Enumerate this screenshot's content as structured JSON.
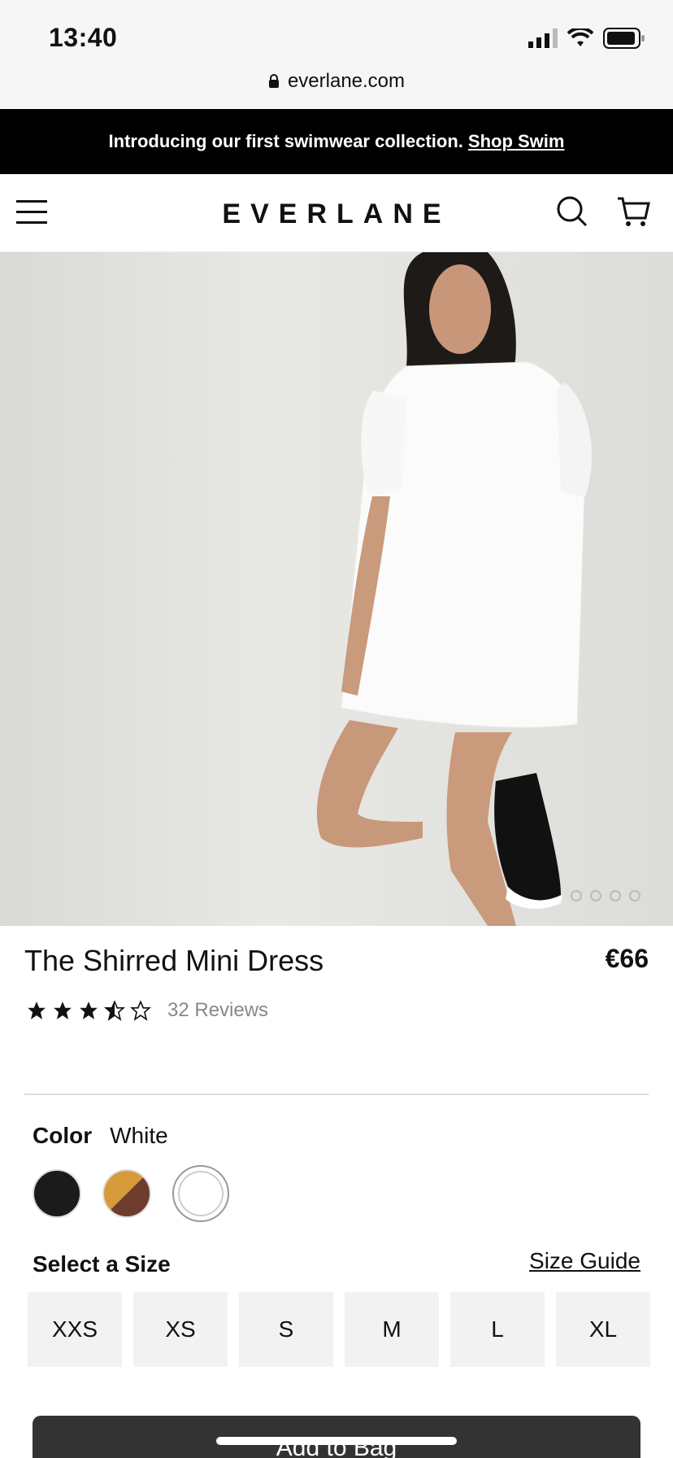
{
  "status_bar": {
    "time": "13:40"
  },
  "browser": {
    "url": "everlane.com"
  },
  "promo": {
    "text": "Introducing our first swimwear collection.",
    "link": "Shop Swim"
  },
  "header": {
    "logo": "EVERLANE"
  },
  "product": {
    "title": "The Shirred Mini Dress",
    "price": "€66",
    "rating": 3.5,
    "reviews": "32 Reviews",
    "image_dots": 4
  },
  "color": {
    "label": "Color",
    "selected": "White",
    "swatches": [
      {
        "name": "black",
        "color": "#1b1b1b"
      },
      {
        "name": "brown-ochre",
        "color": "#6e3c2c"
      },
      {
        "name": "white",
        "color": "#ffffff"
      }
    ]
  },
  "size": {
    "label": "Select a Size",
    "guide": "Size Guide",
    "options": [
      "XXS",
      "XS",
      "S",
      "M",
      "L",
      "XL"
    ]
  },
  "cta": {
    "add_to_bag": "Add to Bag"
  }
}
